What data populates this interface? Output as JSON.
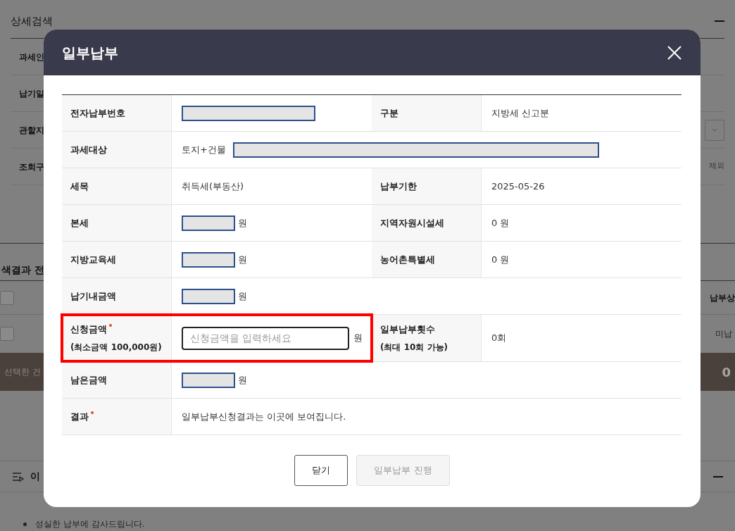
{
  "background": {
    "section_title": "상세검색",
    "filter_labels": [
      "과세인",
      "납기일",
      "관할지",
      "조회구"
    ],
    "filter_note": "제외",
    "results_title": "색결과 전",
    "table_header": "납부상",
    "header_checked": false,
    "row_status": "미납",
    "row_checked": false,
    "selection_label": "선택한 건",
    "selection_total": "0",
    "info_title": "이",
    "info_bullets": [
      "성실한 납부에 감사드립니다."
    ]
  },
  "dialog": {
    "title": "일부납부",
    "rows": [
      {
        "cells": [
          {
            "label": "전자납부번호",
            "kind": "redacted"
          },
          {
            "label": "구분",
            "kind": "text",
            "value": "지방세 신고분"
          }
        ]
      },
      {
        "cells": [
          {
            "label": "과세대상",
            "kind": "redacted",
            "prefix": "토지+건물"
          }
        ]
      },
      {
        "cells": [
          {
            "label": "세목",
            "kind": "text",
            "value": "취득세(부동산)"
          },
          {
            "label": "납부기한",
            "kind": "text",
            "value": "2025-05-26"
          }
        ]
      },
      {
        "cells": [
          {
            "label": "본세",
            "kind": "redacted",
            "unit": "원"
          },
          {
            "label": "지역자원시설세",
            "kind": "text",
            "value": "0 원"
          }
        ]
      },
      {
        "cells": [
          {
            "label": "지방교육세",
            "kind": "redacted",
            "unit": "원"
          },
          {
            "label": "농어촌특별세",
            "kind": "text",
            "value": "0 원"
          }
        ]
      },
      {
        "cells": [
          {
            "label": "납기내금액",
            "kind": "redacted",
            "unit": "원"
          }
        ]
      },
      {
        "cells": [
          {
            "label": "신청금액",
            "required": true,
            "note": "(최소금액 100,000원)",
            "highlighted": true,
            "kind": "input",
            "placeholder": "신청금액을 입력하세요",
            "unit": "원"
          },
          {
            "label": "일부납부횟수",
            "note": "(최대 10회 가능)",
            "kind": "text",
            "value": "0회"
          }
        ]
      },
      {
        "cells": [
          {
            "label": "남은금액",
            "kind": "redacted",
            "unit": "원"
          }
        ]
      },
      {
        "cells": [
          {
            "label": "결과",
            "required": true,
            "kind": "text",
            "value": "일부납부신청결과는 이곳에 보여집니다."
          }
        ]
      }
    ],
    "buttons": [
      {
        "label": "닫기",
        "disabled": false
      },
      {
        "label": "일부납부 진행",
        "disabled": true
      }
    ]
  }
}
